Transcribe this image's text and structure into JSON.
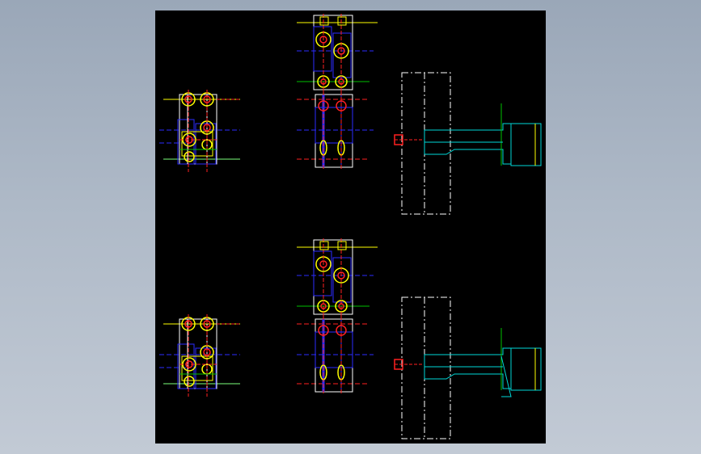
{
  "viewer": {
    "background_color": "#a7b2c1",
    "sheet_color": "#000000"
  },
  "drawing": {
    "colors": {
      "yellow": "#ffff00",
      "red": "#ff2020",
      "blue": "#2b2bff",
      "white": "#ffffff",
      "green": "#00c000",
      "cyan": "#00d8d8",
      "lightgreen": "#7dff7d"
    },
    "views": [
      {
        "name": "side-view-top",
        "kind": "side-assembly"
      },
      {
        "name": "front-view-top",
        "kind": "front-assembly"
      },
      {
        "name": "section-view-top",
        "kind": "section"
      },
      {
        "name": "side-view-bottom",
        "kind": "side-assembly"
      },
      {
        "name": "front-view-bottom",
        "kind": "front-assembly"
      },
      {
        "name": "section-view-bottom",
        "kind": "section"
      }
    ]
  }
}
